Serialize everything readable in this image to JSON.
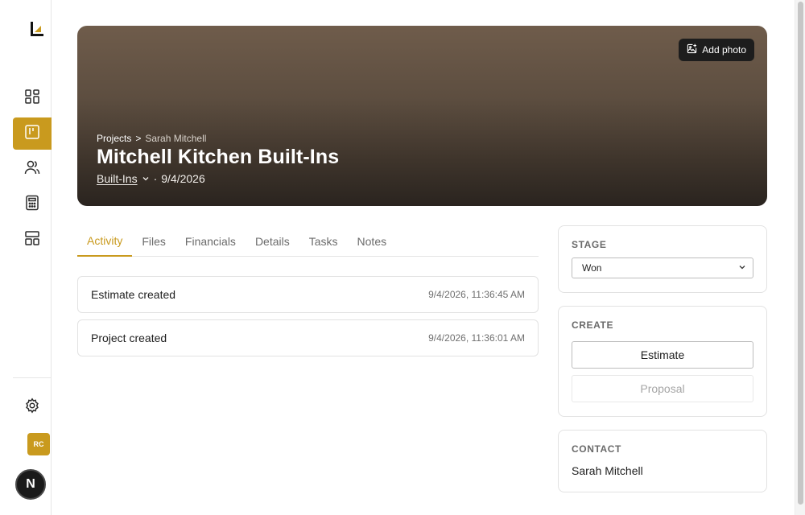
{
  "sidebar": {
    "logo": "logo-mark",
    "nav": [
      {
        "name": "dashboard",
        "icon": "dashboard-icon",
        "active": false
      },
      {
        "name": "projects",
        "icon": "kanban-icon",
        "active": true
      },
      {
        "name": "contacts",
        "icon": "users-icon",
        "active": false
      },
      {
        "name": "estimates",
        "icon": "calculator-icon",
        "active": false
      },
      {
        "name": "templates",
        "icon": "layout-icon",
        "active": false
      }
    ],
    "settings_icon": "gear-icon",
    "user_initials": "RC",
    "badge_letter": "N"
  },
  "hero": {
    "add_photo_label": "Add photo",
    "breadcrumb": {
      "root": "Projects",
      "separator": ">",
      "current": "Sarah Mitchell"
    },
    "title": "Mitchell Kitchen Built-Ins",
    "category": "Built-Ins",
    "date_separator": "·",
    "date": "9/4/2026"
  },
  "tabs": [
    {
      "label": "Activity",
      "active": true
    },
    {
      "label": "Files",
      "active": false
    },
    {
      "label": "Financials",
      "active": false
    },
    {
      "label": "Details",
      "active": false
    },
    {
      "label": "Tasks",
      "active": false
    },
    {
      "label": "Notes",
      "active": false
    }
  ],
  "activity": [
    {
      "title": "Estimate created",
      "time": "9/4/2026, 11:36:45 AM"
    },
    {
      "title": "Project created",
      "time": "9/4/2026, 11:36:01 AM"
    }
  ],
  "stage": {
    "label": "STAGE",
    "value": "Won"
  },
  "create": {
    "label": "CREATE",
    "estimate_label": "Estimate",
    "proposal_label": "Proposal"
  },
  "contact": {
    "label": "CONTACT",
    "name": "Sarah Mitchell"
  },
  "colors": {
    "accent": "#c99a1e",
    "hero_top": "#6f5c4b",
    "hero_bottom": "#2a241f"
  }
}
